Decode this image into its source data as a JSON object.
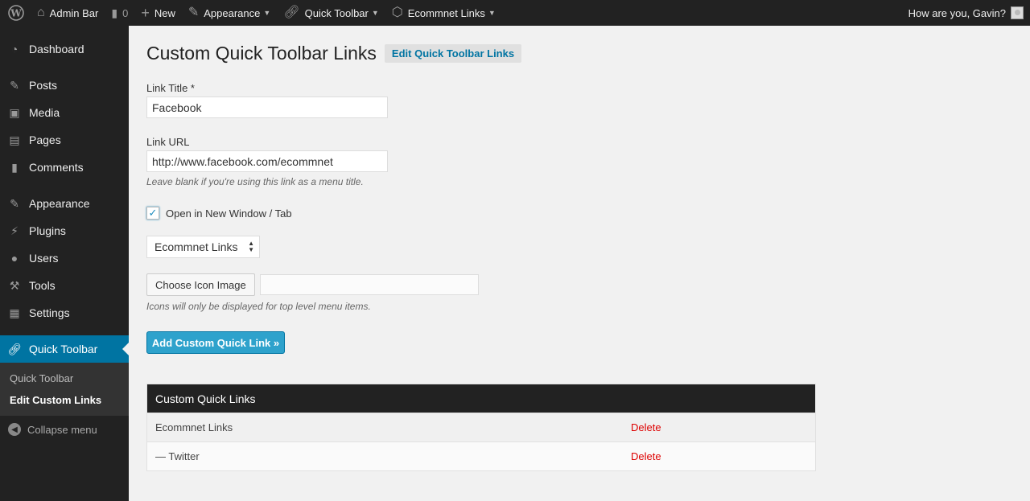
{
  "adminbar": {
    "site_name": "Admin Bar",
    "comments_count": "0",
    "new_label": "New",
    "appearance_label": "Appearance",
    "quick_toolbar_label": "Quick Toolbar",
    "ecommnet_label": "Ecommnet Links",
    "greeting": "How are you, Gavin?"
  },
  "sidebar": {
    "items": [
      {
        "label": "Dashboard",
        "icon": "dashboard-icon"
      },
      {
        "label": "Posts",
        "icon": "pin-icon"
      },
      {
        "label": "Media",
        "icon": "media-icon"
      },
      {
        "label": "Pages",
        "icon": "pages-icon"
      },
      {
        "label": "Comments",
        "icon": "comment-icon"
      },
      {
        "label": "Appearance",
        "icon": "brush-icon"
      },
      {
        "label": "Plugins",
        "icon": "plugin-icon"
      },
      {
        "label": "Users",
        "icon": "user-icon"
      },
      {
        "label": "Tools",
        "icon": "wrench-icon"
      },
      {
        "label": "Settings",
        "icon": "settings-icon"
      },
      {
        "label": "Quick Toolbar",
        "icon": "link-icon"
      }
    ],
    "submenu": [
      "Quick Toolbar",
      "Edit Custom Links"
    ],
    "collapse_label": "Collapse menu"
  },
  "main": {
    "title": "Custom Quick Toolbar Links",
    "edit_link": "Edit Quick Toolbar Links",
    "link_title_label": "Link Title *",
    "link_title_value": "Facebook",
    "link_url_label": "Link URL",
    "link_url_value": "http://www.facebook.com/ecommnet",
    "link_url_hint": "Leave blank if you're using this link as a menu title.",
    "new_window_label": "Open in New Window / Tab",
    "parent_select_value": "Ecommnet Links",
    "choose_icon_label": "Choose Icon Image",
    "icon_hint": "Icons will only be displayed for top level menu items.",
    "add_button_label": "Add Custom Quick Link »"
  },
  "table": {
    "header": "Custom Quick Links",
    "rows": [
      {
        "name": "Ecommnet Links",
        "action": "Delete"
      },
      {
        "name": "— Twitter",
        "action": "Delete"
      }
    ]
  },
  "colors": {
    "accent": "#0074a2",
    "primary_button": "#2ea2cc",
    "delete": "#dd0000",
    "dark": "#222222"
  }
}
